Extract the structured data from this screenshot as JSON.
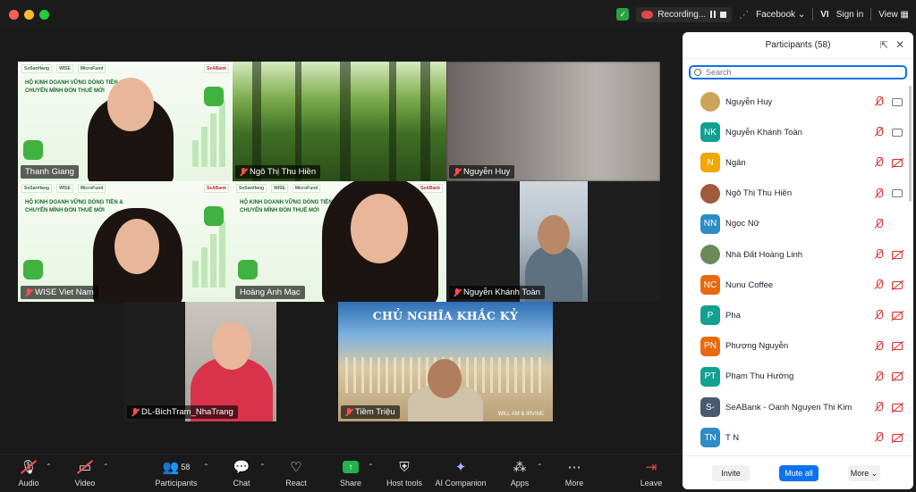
{
  "titlebar": {
    "recording": "Recording...",
    "facebook": "Facebook",
    "lang": "VI",
    "sign_in": "Sign in",
    "view": "View"
  },
  "tiles": [
    {
      "name": "Thanh Giang"
    },
    {
      "name": "Ngô Thị Thu Hiền"
    },
    {
      "name": "Nguyễn Huy"
    },
    {
      "name": "WISE Viet Nam"
    },
    {
      "name": "Hoàng Anh Mạc"
    },
    {
      "name": "Nguyễn Khánh Toàn"
    },
    {
      "name": "DL-BichTram_NhaTrang"
    },
    {
      "name": "Tiềm Triệu"
    }
  ],
  "slide": {
    "logo1": "SoSanHang",
    "logo2": "WISE",
    "logo3": "MicroFund",
    "logo4": "SeABank",
    "headline": "HỘ KINH DOANH VỮNG DÒNG TIỀN & CHUYỂN MÌNH ĐÓN THUẾ MỚI"
  },
  "jerash": {
    "title": "CHỦ NGHĨA KHẮC KỶ",
    "footer": "WILL AM & IRVINE"
  },
  "toolbar": {
    "audio": "Audio",
    "video": "Video",
    "participants": "Participants",
    "participants_count": "58",
    "chat": "Chat",
    "react": "React",
    "share": "Share",
    "host_tools": "Host tools",
    "ai_companion": "AI Companion",
    "apps": "Apps",
    "more": "More",
    "leave": "Leave"
  },
  "panel": {
    "title": "Participants (58)",
    "search_placeholder": "Search",
    "participants": [
      {
        "initials": "",
        "name": "Nguyễn Huy",
        "color": "#c9a45a",
        "cam": "on"
      },
      {
        "initials": "NK",
        "name": "Nguyễn Khánh Toàn",
        "color": "#12a090",
        "cam": "on"
      },
      {
        "initials": "N",
        "name": "Ngân",
        "color": "#f2a600",
        "cam": "off"
      },
      {
        "initials": "",
        "name": "Ngô Thị Thu Hiền",
        "color": "#a05a3c",
        "cam": "on"
      },
      {
        "initials": "NN",
        "name": "Ngọc Nữ",
        "color": "#2d8cc4",
        "cam": "none"
      },
      {
        "initials": "",
        "name": "Nhà Đất Hoàng Linh",
        "color": "#6a8a5a",
        "cam": "off"
      },
      {
        "initials": "NC",
        "name": "Nunu Coffee",
        "color": "#e86a10",
        "cam": "off"
      },
      {
        "initials": "P",
        "name": "Pha",
        "color": "#12a090",
        "cam": "off"
      },
      {
        "initials": "PN",
        "name": "Phượng Nguyễn",
        "color": "#e86a10",
        "cam": "off"
      },
      {
        "initials": "PT",
        "name": "Phạm Thu Hường",
        "color": "#12a090",
        "cam": "off"
      },
      {
        "initials": "S-",
        "name": "SeABank - Oanh Nguyen Thi Kim",
        "color": "#4a5a70",
        "cam": "off"
      },
      {
        "initials": "TN",
        "name": "T N",
        "color": "#2d8cc4",
        "cam": "off"
      }
    ],
    "invite": "Invite",
    "mute_all": "Mute all",
    "more": "More"
  },
  "colors": {
    "active_speaker": "#3ec94a",
    "accent": "#0e72ed",
    "muted": "#e02828"
  }
}
